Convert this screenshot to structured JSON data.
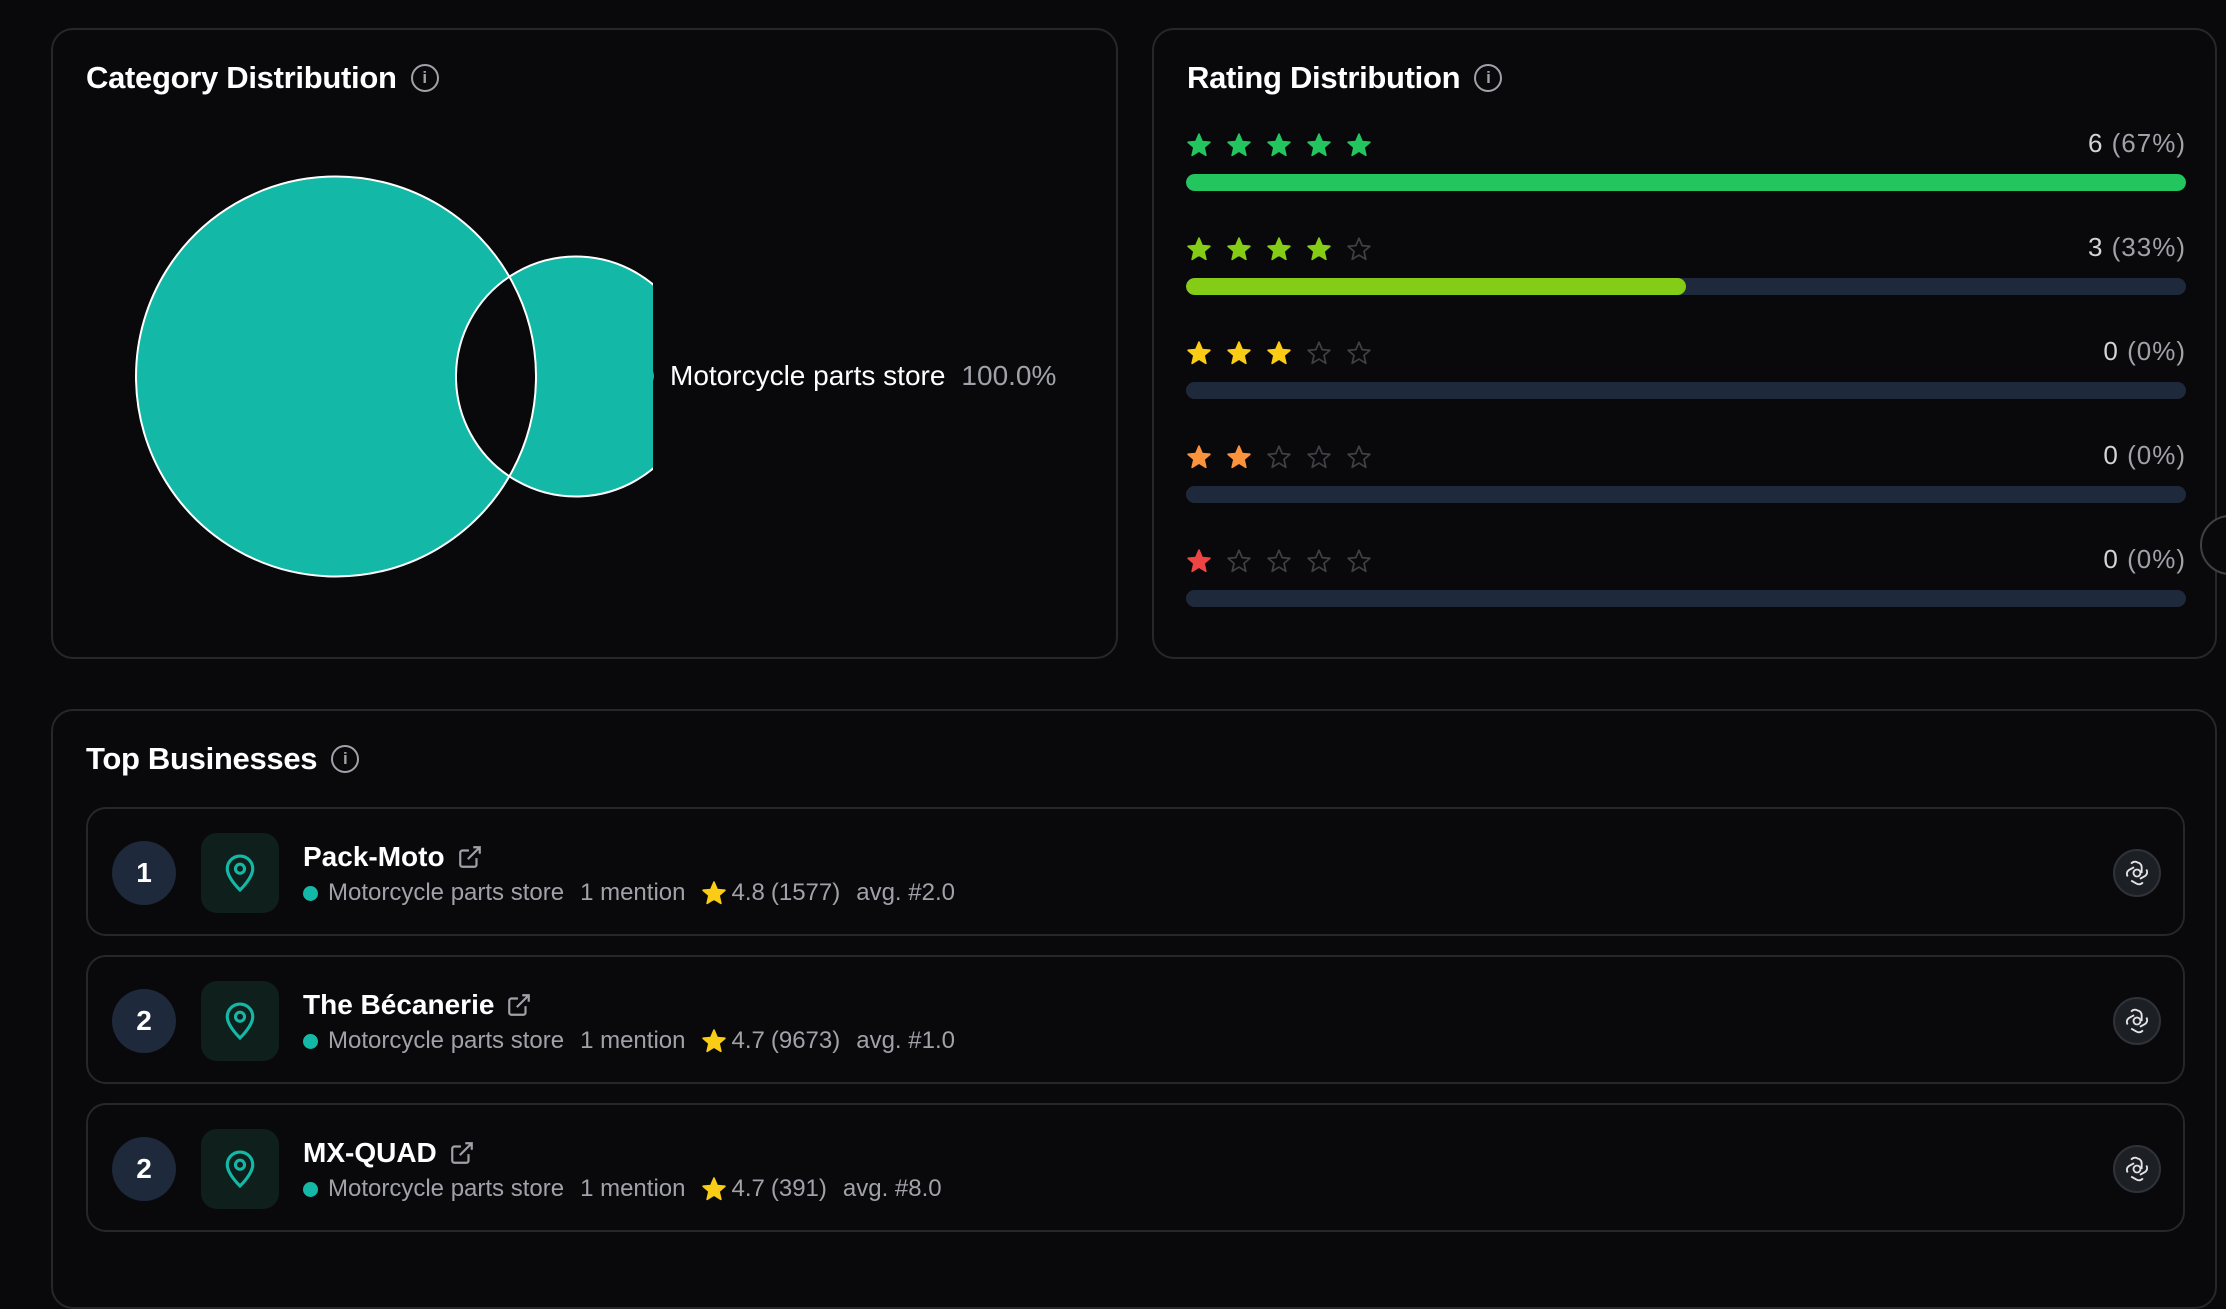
{
  "category": {
    "title": "Category Distribution",
    "slices": [
      {
        "label": "Motorcycle parts store",
        "value": 100.0,
        "pct_label": "100.0%",
        "color": "#14b8a6"
      }
    ]
  },
  "rating": {
    "title": "Rating Distribution",
    "rows": [
      {
        "stars": 5,
        "count": "6",
        "pct": "(67%)",
        "fill": 1.0,
        "color": "#22c55e"
      },
      {
        "stars": 4,
        "count": "3",
        "pct": "(33%)",
        "fill": 0.5,
        "color": "#84cc16"
      },
      {
        "stars": 3,
        "count": "0",
        "pct": "(0%)",
        "fill": 0,
        "color": "#facc15"
      },
      {
        "stars": 2,
        "count": "0",
        "pct": "(0%)",
        "fill": 0,
        "color": "#fb923c"
      },
      {
        "stars": 1,
        "count": "0",
        "pct": "(0%)",
        "fill": 0,
        "color": "#ef4444"
      }
    ]
  },
  "top": {
    "title": "Top Businesses",
    "items": [
      {
        "rank": "1",
        "name": "Pack-Moto",
        "category": "Motorcycle parts store",
        "mentions": "1 mention",
        "rating": "4.8",
        "reviews": "(1577)",
        "avg": "avg. #2.0"
      },
      {
        "rank": "2",
        "name": "The Bécanerie",
        "category": "Motorcycle parts store",
        "mentions": "1 mention",
        "rating": "4.7",
        "reviews": "(9673)",
        "avg": "avg. #1.0"
      },
      {
        "rank": "2",
        "name": "MX-QUAD",
        "category": "Motorcycle parts store",
        "mentions": "1 mention",
        "rating": "4.7",
        "reviews": "(391)",
        "avg": "avg. #8.0"
      }
    ]
  }
}
